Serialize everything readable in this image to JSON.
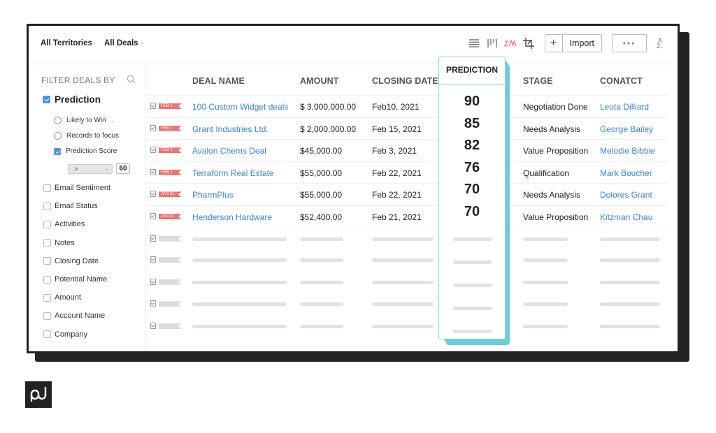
{
  "toolbar": {
    "territories_label": "All Territories",
    "deals_label": "All Deals",
    "import_label": "Import",
    "more_label": "•••",
    "icons": [
      "list-view-icon",
      "kanban-view-icon",
      "zia-icon",
      "crop-icon",
      "plus-icon",
      "more-icon",
      "sort-az-icon"
    ]
  },
  "sidebar": {
    "title": "FILTER DEALS BY",
    "prediction": {
      "label": "Prediction",
      "checked": true
    },
    "sub_options": [
      {
        "label": "Likely to Win",
        "type": "radio",
        "checked": false
      },
      {
        "label": "Records to focus",
        "type": "radio",
        "checked": false
      },
      {
        "label": "Prediction Score",
        "type": "checkbox",
        "checked": true
      }
    ],
    "operator": ">",
    "score_value": "60",
    "filters": [
      "Email Sentiment",
      "Email Status",
      "Activities",
      "Notes",
      "Closing Date",
      "Potential Name",
      "Amount",
      "Account Name",
      "Company"
    ]
  },
  "table": {
    "columns": [
      "DEAL NAME",
      "AMOUNT",
      "CLOSING DATE",
      "PREDICTION",
      "STAGE",
      "CONATCT"
    ],
    "rows": [
      {
        "tag": "FEB 1",
        "deal": "100 Custom Widget deals",
        "amount": "$ 3,000,000.00",
        "date": "Feb10, 2021",
        "prediction": "90",
        "stage": "Negotiation Done",
        "contact": "Leota Dilliard"
      },
      {
        "tag": "FEB 1",
        "deal": "Grant Industries Ltd.",
        "amount": "$ 2,000,000.00",
        "date": "Feb 15, 2021",
        "prediction": "85",
        "stage": "Needs Analysis",
        "contact": "George Bailey"
      },
      {
        "tag": "FEB 1",
        "deal": "Avalon Chems Deal",
        "amount": "$45,000.00",
        "date": "Feb 3, 2021",
        "prediction": "82",
        "stage": "Value Proposition",
        "contact": "Melodie Bibbie"
      },
      {
        "tag": "FEB 1",
        "deal": "Terraform Real Estate",
        "amount": "$55,000.00",
        "date": "Feb 22, 2021",
        "prediction": "76",
        "stage": "Qualification",
        "contact": "Mark Boucher"
      },
      {
        "tag": "JAN 31",
        "deal": "PharmPlus",
        "amount": "$55,000.00",
        "date": "Feb 22, 2021",
        "prediction": "70",
        "stage": "Needs Analysis",
        "contact": "Dolores Grant"
      },
      {
        "tag": "JAN 31",
        "deal": "Henderson Hardware",
        "amount": "$52,400.00",
        "date": "Feb 21, 2021",
        "prediction": "70",
        "stage": "Value Proposition",
        "contact": "Kitzman Chau"
      }
    ],
    "placeholder_rows": 5
  },
  "colors": {
    "accent_link": "#3a84d8",
    "prediction_highlight": "#6dcdd6",
    "tag_red": "#ef7272",
    "checkbox_blue": "#4b92e6"
  },
  "logo": {
    "name": "pd-logo",
    "text": "pd"
  }
}
